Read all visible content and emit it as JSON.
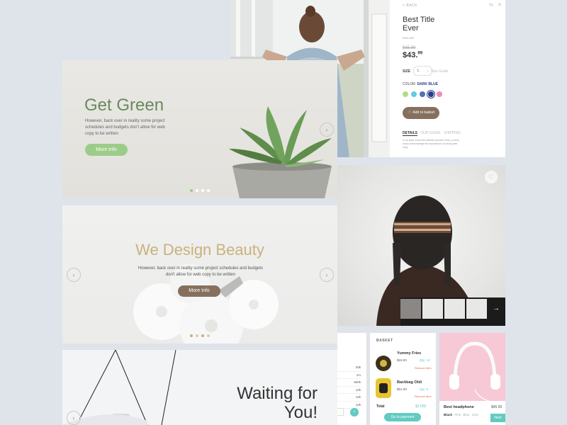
{
  "product": {
    "back": "< BACK",
    "title_line1": "Best Title",
    "title_line2": "Ever",
    "sku": "RX5-4S2",
    "old_price": "$65.99",
    "price": "$43.",
    "price_cents": "99",
    "size_label": "SIZE",
    "size_value": "L",
    "size_guide": "Size Guide",
    "color_label": "COLOR:",
    "color_value": "DARK BLUE",
    "swatches": [
      "#b7d98a",
      "#66c7e3",
      "#5070b8",
      "#2c3a8c",
      "#f08bb8"
    ],
    "add_to_basket": "Add to basket",
    "tabs": [
      "DETAILS",
      "OUR GUIDE",
      "SHIPPING"
    ],
    "description": "In an ideal world this website wouldn't exist, a client would acknowledge the importance of having web copy"
  },
  "hero_green": {
    "title": "Get Green",
    "body": "However, back over in reality some project schedules and budgets don't allow for web copy to be written",
    "button": "More Info"
  },
  "hero_beauty": {
    "title": "We Design Beauty",
    "body": "However, back over in reality some project schedules and budgets don't allow for web copy to be written",
    "button": "More Info"
  },
  "hero_waiting": {
    "title_line1": "Waiting for",
    "title_line2": "You!"
  },
  "table": {
    "values": [
      "20k",
      "1m",
      "500k",
      "12k",
      "12k",
      "12k"
    ]
  },
  "basket": {
    "title": "BASKET",
    "items": [
      {
        "name": "Yummy Fries",
        "price": "$15.00",
        "qty": "Qty: 10",
        "remove": "Remove item"
      },
      {
        "name": "Backbag Oldi",
        "price": "$51.00",
        "qty": "Qty: 5",
        "remove": "Remove item"
      }
    ],
    "total_label": "Total",
    "total_value": "$2,000",
    "checkout": "Go to payment"
  },
  "headphone": {
    "name": "Best headphone",
    "price": "$45.00",
    "colors": [
      "Black",
      "Pink",
      "Blue",
      "Grey"
    ],
    "next": "Next"
  },
  "colors": {
    "green_accent": "#9ccc8a",
    "brown_accent": "#86705d",
    "teal_accent": "#62cbc0",
    "sale_red": "#e8663c"
  }
}
